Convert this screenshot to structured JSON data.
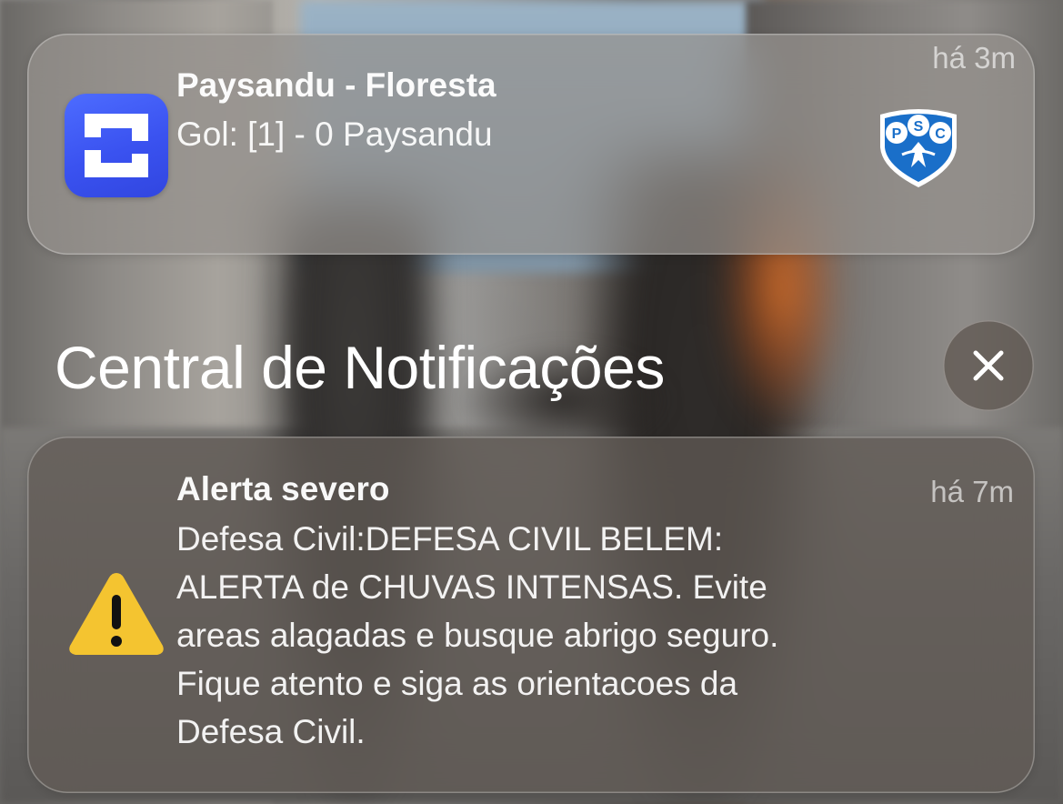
{
  "notifications": [
    {
      "app": "sports-app",
      "title": "Paysandu - Floresta",
      "body": "Gol: [1] - 0 Paysandu",
      "time": "há 3m",
      "attachment_icon": "psc-club-badge",
      "badge_letters": [
        "P",
        "S",
        "C"
      ]
    }
  ],
  "section": {
    "title": "Central de Notificações",
    "close_icon": "close-icon"
  },
  "alert": {
    "title": "Alerta severo",
    "time": "há 7m",
    "icon": "warning-icon",
    "body_lines": [
      "Defesa Civil:DEFESA CIVIL BELEM:",
      "ALERTA de CHUVAS INTENSAS. Evite",
      "areas alagadas e busque abrigo seguro.",
      "Fique atento e siga as orientacoes da",
      "Defesa Civil."
    ]
  },
  "colors": {
    "app_icon": "#3a52f0",
    "warning": "#f4c430",
    "club_blue": "#1a6fc9"
  }
}
